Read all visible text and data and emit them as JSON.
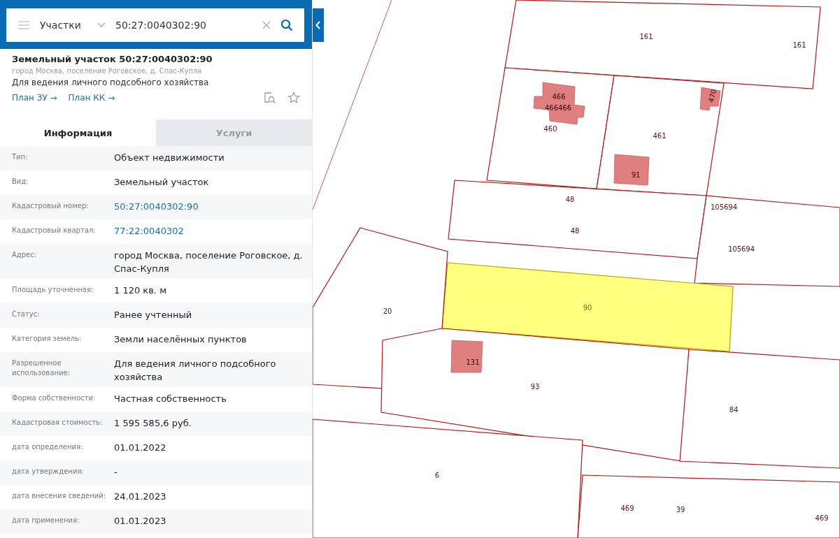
{
  "search": {
    "layer": "Участки",
    "value": "50:27:0040302:90"
  },
  "card": {
    "title": "Земельный участок 50:27:0040302:90",
    "address": "город Москва, поселение Роговское, д. Спас-Купля",
    "purpose": "Для ведения личного подсобного хозяйства",
    "links": [
      "План ЗУ →",
      "План КК →"
    ]
  },
  "tabs": [
    {
      "label": "Информация",
      "selected": true
    },
    {
      "label": "Услуги",
      "selected": false
    }
  ],
  "rows": [
    {
      "label": "Тип:",
      "value": "Объект недвижимости",
      "kind": "text"
    },
    {
      "label": "Вид:",
      "value": "Земельный участок",
      "kind": "text"
    },
    {
      "label": "Кадастровый номер:",
      "value": "50:27:0040302:90",
      "kind": "link"
    },
    {
      "label": "Кадастровый квартал:",
      "value": "77:22:0040302",
      "kind": "link"
    },
    {
      "label": "Адрес:",
      "value": "город Москва, поселение Роговское, д. Спас-Купля",
      "kind": "text"
    },
    {
      "label": "Площадь уточненная:",
      "value": "1 120 кв. м",
      "kind": "text"
    },
    {
      "label": "Статус:",
      "value": "Ранее учтенный",
      "kind": "text"
    },
    {
      "label": "Категория земель:",
      "value": "Земли населённых пунктов",
      "kind": "text"
    },
    {
      "label": "Разрешенное использование:",
      "value": "Для ведения личного подсобного хозяйства",
      "kind": "text"
    },
    {
      "label": "Форма собственности:",
      "value": "Частная собственность",
      "kind": "text"
    },
    {
      "label": "Кадастровая стоимость:",
      "value": "1 595 585,6 руб.",
      "kind": "text"
    },
    {
      "label": "дата определения:",
      "value": "01.01.2022",
      "kind": "text"
    },
    {
      "label": "дата утверждения:",
      "value": "-",
      "kind": "text"
    },
    {
      "label": "дата внесения сведений:",
      "value": "24.01.2023",
      "kind": "text"
    },
    {
      "label": "дата применения:",
      "value": "01.01.2023",
      "kind": "text"
    }
  ],
  "map": {
    "parcels": [
      {
        "labels": [
          "161",
          "161"
        ],
        "selected": false
      },
      {
        "labels": [
          "460"
        ],
        "selected": false
      },
      {
        "labels": [
          "461"
        ],
        "selected": false
      },
      {
        "labels": [
          "48",
          "48"
        ],
        "selected": false
      },
      {
        "labels": [
          "105694",
          "105694"
        ],
        "selected": false
      },
      {
        "labels": [
          "90"
        ],
        "selected": true
      },
      {
        "labels": [
          "20"
        ],
        "selected": false
      },
      {
        "labels": [
          "93"
        ],
        "selected": false
      },
      {
        "labels": [
          "84"
        ],
        "selected": false
      },
      {
        "labels": [
          "6"
        ],
        "selected": false
      },
      {
        "labels": [
          "469",
          "39",
          "469"
        ],
        "selected": false
      }
    ],
    "buildings": [
      {
        "labels": [
          "466",
          "466466"
        ]
      },
      {
        "labels": [
          "91"
        ]
      },
      {
        "labels": [
          "470"
        ]
      },
      {
        "labels": [
          "131"
        ]
      }
    ]
  }
}
